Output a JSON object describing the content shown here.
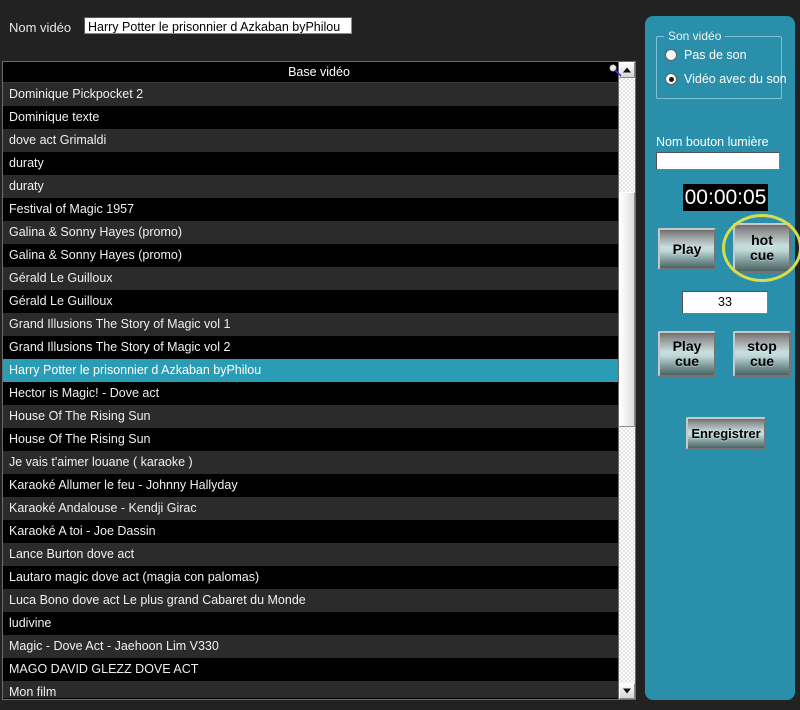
{
  "form": {
    "video_name_label": "Nom vidéo",
    "video_name_value": "Harry Potter le prisonnier d Azkaban byPhilou"
  },
  "list": {
    "header": "Base vidéo",
    "selected_index": 12,
    "rows": [
      "Dominique Pickpocket 2",
      "Dominique texte",
      "dove act Grimaldi",
      "duraty",
      "duraty",
      "Festival of Magic 1957",
      "Galina & Sonny Hayes (promo)",
      "Galina & Sonny Hayes (promo)",
      "Gérald Le Guilloux",
      "Gérald Le Guilloux",
      "Grand Illusions The Story of Magic vol 1",
      "Grand Illusions   The Story of Magic   vol 2",
      "Harry Potter le prisonnier d Azkaban byPhilou",
      "Hector is Magic! - Dove act",
      "House Of The Rising Sun",
      "House Of The Rising Sun",
      "Je vais t'aimer louane ( karaoke )",
      "Karaoké Allumer le feu - Johnny Hallyday",
      "Karaoké Andalouse - Kendji Girac",
      "Karaoké A toi - Joe Dassin",
      "Lance Burton dove act",
      "Lautaro magic dove act (magia con palomas)",
      "Luca Bono dove act Le plus grand Cabaret du Monde",
      "ludivine",
      "Magic - Dove Act - Jaehoon Lim V330",
      "MAGO DAVID GLEZZ   DOVE ACT",
      "Mon film"
    ]
  },
  "scrollbar": {
    "up_arrow": "scroll-up",
    "down_arrow": "scroll-down"
  },
  "panel": {
    "sound_group_title": "Son vidéo",
    "radio_no_sound": "Pas de son",
    "radio_with_sound": "Vidéo avec du son",
    "radio_no_sound_checked": false,
    "radio_with_sound_checked": true,
    "light_button_label": "Nom bouton lumière",
    "light_button_value": "",
    "light_button_placeholder": "",
    "timer": "00:00:05",
    "btn_play": "Play",
    "btn_hot_cue": "hot\ncue",
    "btn_hot_cue_line1": "hot",
    "btn_hot_cue_line2": "cue",
    "btn_play_cue_line1": "Play",
    "btn_play_cue_line2": "cue",
    "btn_stop_cue_line1": "stop",
    "btn_stop_cue_line2": "cue",
    "cue_number": "33",
    "btn_save": "Enregistrer",
    "highlight_color": "#d8dd49",
    "panel_color": "#2a8fab",
    "selection_color": "#2a9cb5"
  }
}
